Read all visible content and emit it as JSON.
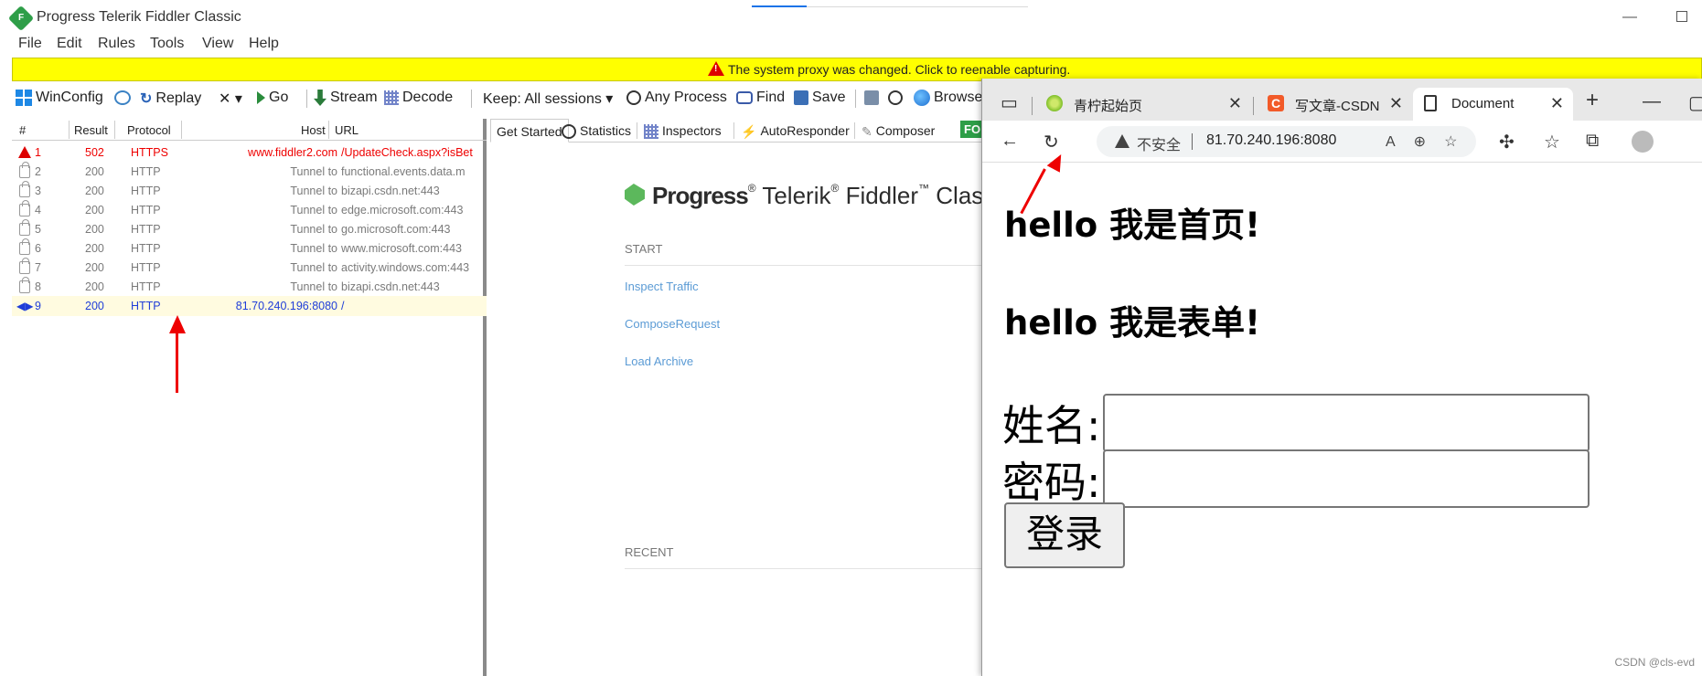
{
  "fiddler": {
    "title": "Progress Telerik Fiddler Classic",
    "menu": [
      "File",
      "Edit",
      "Rules",
      "Tools",
      "View",
      "Help"
    ],
    "warning": "The system proxy was changed. Click to reenable capturing.",
    "toolbar": {
      "winconfig": "WinConfig",
      "replay": "Replay",
      "x_dropdown": "✕ ▾",
      "go": "Go",
      "stream": "Stream",
      "decode": "Decode",
      "keep": "Keep: All sessions ▾",
      "any_process": "Any Process",
      "find": "Find",
      "save": "Save",
      "browse": "Browse"
    },
    "columns": [
      "#",
      "Result",
      "Protocol",
      "Host",
      "URL"
    ],
    "sessions": [
      {
        "num": "1",
        "result": "502",
        "protocol": "HTTPS",
        "host": "www.fiddler2.com",
        "url": "/UpdateCheck.aspx?isBet"
      },
      {
        "num": "2",
        "result": "200",
        "protocol": "HTTP",
        "host": "Tunnel to",
        "url": "functional.events.data.m"
      },
      {
        "num": "3",
        "result": "200",
        "protocol": "HTTP",
        "host": "Tunnel to",
        "url": "bizapi.csdn.net:443"
      },
      {
        "num": "4",
        "result": "200",
        "protocol": "HTTP",
        "host": "Tunnel to",
        "url": "edge.microsoft.com:443"
      },
      {
        "num": "5",
        "result": "200",
        "protocol": "HTTP",
        "host": "Tunnel to",
        "url": "go.microsoft.com:443"
      },
      {
        "num": "6",
        "result": "200",
        "protocol": "HTTP",
        "host": "Tunnel to",
        "url": "www.microsoft.com:443"
      },
      {
        "num": "7",
        "result": "200",
        "protocol": "HTTP",
        "host": "Tunnel to",
        "url": "activity.windows.com:443"
      },
      {
        "num": "8",
        "result": "200",
        "protocol": "HTTP",
        "host": "Tunnel to",
        "url": "bizapi.csdn.net:443"
      },
      {
        "num": "9",
        "result": "200",
        "protocol": "HTTP",
        "host": "81.70.240.196:8080",
        "url": "/"
      }
    ],
    "right_tabs": [
      "Get Started",
      "Statistics",
      "Inspectors",
      "AutoResponder",
      "Composer",
      "FO"
    ],
    "brand": {
      "progress": "Progress",
      "telerik": "Telerik",
      "fiddler": "Fiddler",
      "classic": "Classic"
    },
    "start_label": "START",
    "links": [
      "Inspect Traffic",
      "ComposeRequest",
      "Load Archive"
    ],
    "recent_label": "RECENT"
  },
  "edge": {
    "tabs": [
      {
        "title": "青柠起始页",
        "close": "✕"
      },
      {
        "title": "写文章-CSDN",
        "close": "✕"
      },
      {
        "title": "Document",
        "close": "✕"
      }
    ],
    "new_tab": "+",
    "address": {
      "insecure": "不安全",
      "url": "81.70.240.196:8080"
    },
    "page": {
      "heading1": "hello 我是首页!",
      "heading2": "hello 我是表单!",
      "name_label": "姓名:",
      "password_label": "密码:",
      "login_button": "登录"
    }
  },
  "watermark": "CSDN @cls-evd"
}
